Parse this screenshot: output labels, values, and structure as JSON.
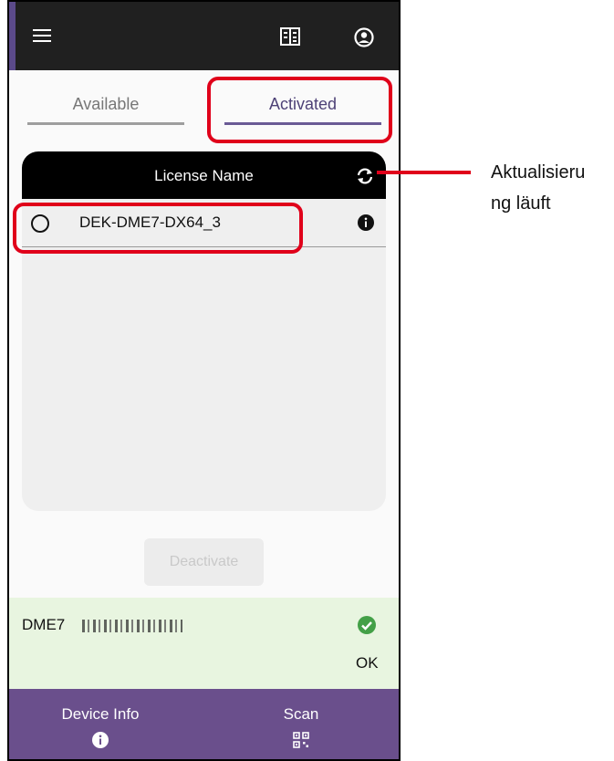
{
  "tabs": {
    "available": "Available",
    "activated": "Activated"
  },
  "license_table": {
    "header": "License Name",
    "rows": [
      {
        "name": "DEK-DME7-DX64_3"
      }
    ]
  },
  "deactivate_label": "Deactivate",
  "device_status": {
    "device": "DME7",
    "status": "OK"
  },
  "bottom_nav": {
    "device_info": "Device Info",
    "scan": "Scan"
  },
  "callout": {
    "line1": "Aktualisieru",
    "line2": "ng läuft"
  },
  "colors": {
    "appbar": "#202020",
    "accent": "#6a4f8c",
    "highlight": "#e0001a",
    "status_bg": "#e8f5e0",
    "ok_green": "#43a047"
  }
}
